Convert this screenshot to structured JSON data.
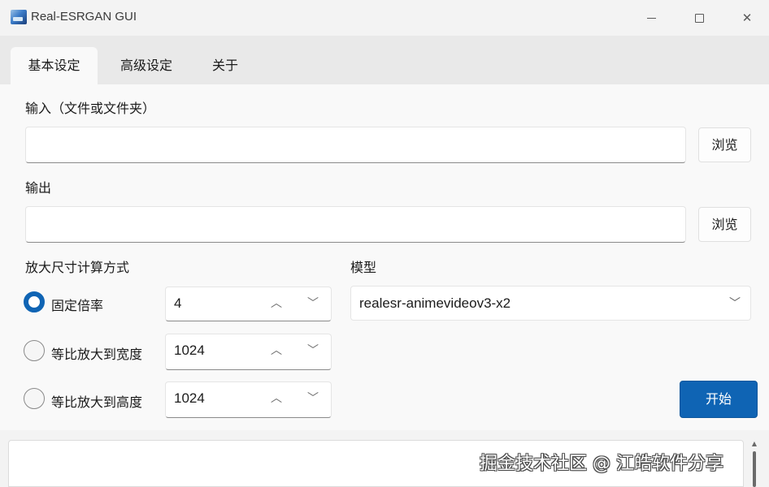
{
  "window": {
    "title": "Real-ESRGAN GUI",
    "min_glyph": "—",
    "close_glyph": "✕"
  },
  "tabs": [
    {
      "label": "基本设定",
      "active": true
    },
    {
      "label": "高级设定",
      "active": false
    },
    {
      "label": "关于",
      "active": false
    }
  ],
  "input": {
    "label": "输入（文件或文件夹）",
    "value": "",
    "browse_label": "浏览"
  },
  "output": {
    "label": "输出",
    "value": "",
    "browse_label": "浏览"
  },
  "scale": {
    "label": "放大尺寸计算方式",
    "options": [
      {
        "label": "固定倍率",
        "value": "4",
        "checked": true
      },
      {
        "label": "等比放大到宽度",
        "value": "1024",
        "checked": false
      },
      {
        "label": "等比放大到高度",
        "value": "1024",
        "checked": false
      }
    ]
  },
  "model": {
    "label": "模型",
    "selected": "realesr-animevideov3-x2"
  },
  "start_label": "开始",
  "log": {
    "text": ""
  },
  "watermark": "掘金技术社区 @ 江皓软件分享",
  "colors": {
    "accent": "#0f64b4",
    "background": "#f3f3f3",
    "panel": "#f9f9f9"
  }
}
